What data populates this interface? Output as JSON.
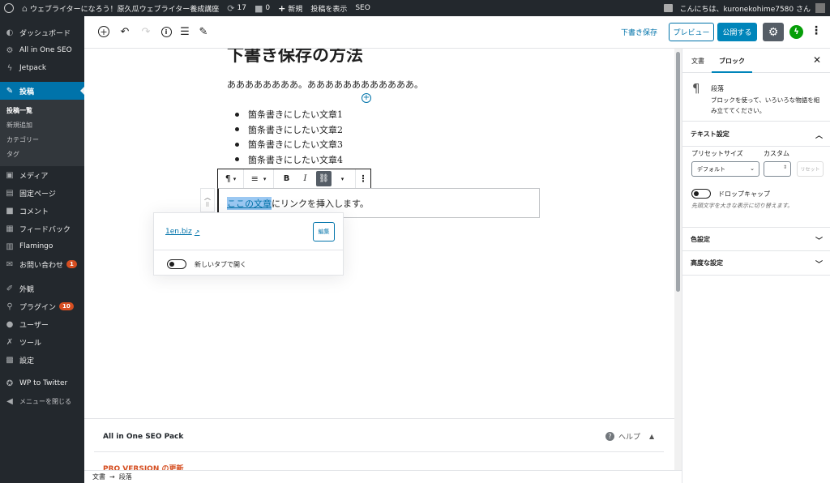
{
  "adminbar": {
    "site_name": "ウェブライターになろう！原久瓜ウェブライター養成講座",
    "updates_count": "17",
    "comments_count": "0",
    "new_label": "新規",
    "view_post_label": "投稿を表示",
    "seo_label": "SEO",
    "greeting": "こんにちは、kuronekohime7580 さん"
  },
  "sidebar": {
    "items": [
      {
        "label": "ダッシュボード",
        "icon": "dashboard-icon"
      },
      {
        "label": "All in One SEO",
        "icon": "gear-icon"
      },
      {
        "label": "Jetpack",
        "icon": "jetpack-icon"
      }
    ],
    "active_item": {
      "label": "投稿",
      "icon": "pin-icon"
    },
    "submenu": [
      "投稿一覧",
      "新規追加",
      "カテゴリー",
      "タグ"
    ],
    "items2": [
      {
        "label": "メディア",
        "icon": "media-icon"
      },
      {
        "label": "固定ページ",
        "icon": "page-icon"
      },
      {
        "label": "コメント",
        "icon": "comment-icon"
      },
      {
        "label": "フィードバック",
        "icon": "feedback-icon"
      },
      {
        "label": "Flamingo",
        "icon": "flamingo-icon"
      },
      {
        "label": "お問い合わせ",
        "icon": "mail-icon",
        "badge": "1"
      }
    ],
    "items3": [
      {
        "label": "外観",
        "icon": "brush-icon"
      },
      {
        "label": "プラグイン",
        "icon": "plugin-icon",
        "badge": "10"
      },
      {
        "label": "ユーザー",
        "icon": "user-icon"
      },
      {
        "label": "ツール",
        "icon": "wrench-icon"
      },
      {
        "label": "設定",
        "icon": "settings-icon"
      }
    ],
    "items4": [
      {
        "label": "WP to Twitter",
        "icon": "twitter-icon"
      },
      {
        "label": "メニューを閉じる",
        "icon": "collapse-icon"
      }
    ]
  },
  "header": {
    "save_draft": "下書き保存",
    "preview": "プレビュー",
    "publish": "公開する"
  },
  "editor": {
    "title": "下書き保存の方法",
    "paragraph": "ああああああああ。ああああああああああああ。",
    "list_items": [
      "箇条書きにしたい文章1",
      "箇条書きにしたい文章2",
      "箇条書きにしたい文章3",
      "箇条書きにしたい文章4"
    ],
    "active_block_highlight": "ここの文章",
    "active_block_rest": "にリンクを挿入します。",
    "toolbar": {
      "bold": "B",
      "italic": "I"
    }
  },
  "link_popover": {
    "url": "1en.biz",
    "edit_label": "編集",
    "toggle_label": "新しいタブで開く"
  },
  "seo_panel": {
    "title": "All in One SEO Pack",
    "help_label": "ヘルプ",
    "pro_label": "PRO VERSION の更新"
  },
  "footer": {
    "breadcrumb_root": "文書",
    "breadcrumb_arrow": "→",
    "breadcrumb_current": "段落"
  },
  "settings": {
    "tab_document": "文書",
    "tab_block": "ブロック",
    "block_name": "段落",
    "block_desc": "ブロックを使って、いろいろな物語を組み立ててください。",
    "text_settings": "テキスト設定",
    "preset_size_label": "プリセットサイズ",
    "custom_label": "カスタム",
    "preset_value": "デフォルト",
    "reset_label": "リセット",
    "drop_cap_label": "ドロップキャップ",
    "drop_cap_help": "先頭文字を大きな表示に切り替えます。",
    "color_settings": "色設定",
    "advanced_settings": "高度な設定"
  }
}
